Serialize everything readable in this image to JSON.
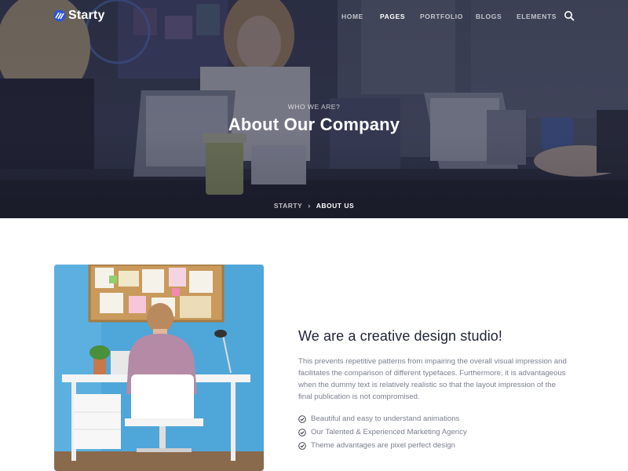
{
  "brand": {
    "name": "Starty"
  },
  "nav": {
    "items": [
      {
        "label": "HOME",
        "active": false
      },
      {
        "label": "PAGES",
        "active": true
      },
      {
        "label": "PORTFOLIO",
        "active": false
      },
      {
        "label": "BLOGS",
        "active": false
      },
      {
        "label": "ELEMENTS",
        "active": false
      }
    ],
    "search_icon": "search-icon"
  },
  "hero": {
    "subtitle": "WHO WE ARE?",
    "title": "About Our Company",
    "breadcrumb": {
      "home": "STARTY",
      "separator_icon": "chevron-right-icon",
      "current": "ABOUT US"
    }
  },
  "about": {
    "heading": "We are a creative design studio!",
    "paragraph": "This prevents repetitive patterns from impairing the overall visual impression and facilitates the comparison of different typefaces. Furthermore, it is advantageous when the dummy text is relatively realistic so that the layout impression of the final publication is not compromised.",
    "features": [
      "Beautiful and easy to understand animations",
      "Our Talented & Experienced Marketing Agency",
      "Theme advantages are pixel perfect design"
    ],
    "feature_icon": "check-circle-icon"
  },
  "colors": {
    "accent": "#2f55d4",
    "heading": "#232638",
    "body_text": "#7c8090"
  }
}
